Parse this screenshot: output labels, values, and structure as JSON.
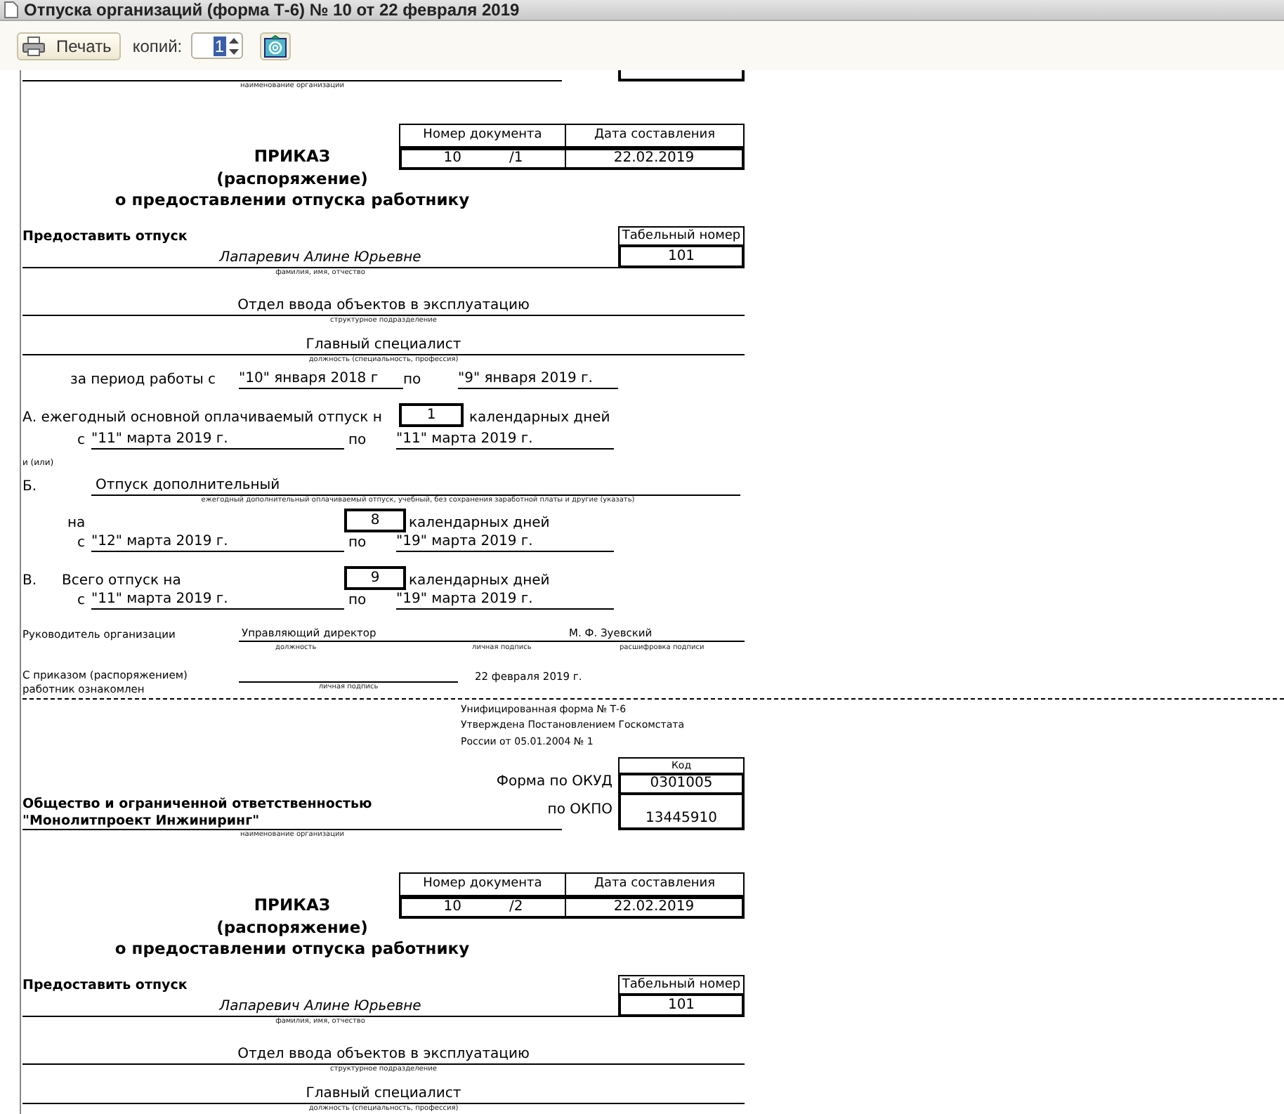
{
  "window": {
    "title": "Отпуска организаций (форма Т-6) № 10 от 22 февраля 2019"
  },
  "toolbar": {
    "print_button": "Печать",
    "copies_label": "копий:",
    "copies_value": "1"
  },
  "documents": [
    {
      "header": {
        "org_caption": "наименование организации"
      },
      "doc_table": {
        "number_header": "Номер документа",
        "date_header": "Дата составления",
        "number": "10",
        "suffix": "/1",
        "date": "22.02.2019"
      },
      "title": [
        "ПРИКАЗ",
        "(распоряжение)",
        "о предоставлении отпуска работнику"
      ],
      "grant_label": "Предоставить отпуск",
      "tab_header": "Табельный номер",
      "tab_number": "101",
      "employee": {
        "value": "Лапаревич Алине Юрьевне",
        "caption": "фамилия, имя, отчество"
      },
      "department": {
        "value": "Отдел ввода объектов в эксплуатацию",
        "caption": "структурное подразделение"
      },
      "position": {
        "value": "Главный специалист",
        "caption": "должность (специальность, профессия)"
      },
      "period": {
        "label": "за период работы с",
        "from": "\"10\" января 2018 г",
        "to_label": "по",
        "to": "\"9\" января 2019 г."
      },
      "leave_a": {
        "label": "А. ежегодный основной оплачиваемый отпуск н",
        "days": "1",
        "days_label": "календарных дней",
        "from_label": "с",
        "from": "\"11\" марта 2019 г.",
        "to_label": "по",
        "to": "\"11\" марта 2019 г."
      },
      "and_or": "и (или)",
      "leave_b": {
        "letter": "Б.",
        "type": "Отпуск дополнительный",
        "caption": "ежегодный дополнительный оплачиваемый отпуск, учебный, без сохранения заработной платы и другие (указать)",
        "on_label": "на",
        "days": "8",
        "days_label": "календарных дней",
        "from_label": "с",
        "from": "\"12\" марта 2019 г.",
        "to_label": "по",
        "to": "\"19\" марта 2019 г."
      },
      "total": {
        "letter": "В.",
        "label": "Всего отпуск на",
        "days": "9",
        "days_label": "календарных дней",
        "from_label": "с",
        "from": "\"11\" марта 2019 г.",
        "to_label": "по",
        "to": "\"19\" марта 2019 г."
      },
      "head_signature": {
        "label": "Руководитель организации",
        "position": "Управляющий директор",
        "name": "М. Ф. Зуевский",
        "captions": [
          "должность",
          "личная подпись",
          "расшифровка подписи"
        ]
      },
      "acknowledgement": {
        "label_lines": [
          "С приказом (распоряжением)",
          "работник ознакомлен"
        ],
        "caption": "личная подпись",
        "date": "22 февраля 2019 г."
      }
    },
    {
      "header": {
        "form_note": [
          "Унифицированная форма № Т-6",
          "Утверждена Постановлением Госкомстата",
          "России от 05.01.2004 № 1"
        ],
        "code_header": "Код",
        "okud_label": "Форма по ОКУД",
        "okud": "0301005",
        "okpo_label": "по ОКПО",
        "okpo": "13445910",
        "org_name": [
          "Общество и ограниченной ответственностью",
          "\"Монолитпроект Инжиниринг\""
        ],
        "org_caption": "наименование организации"
      },
      "doc_table": {
        "number_header": "Номер документа",
        "date_header": "Дата составления",
        "number": "10",
        "suffix": "/2",
        "date": "22.02.2019"
      },
      "title": [
        "ПРИКАЗ",
        "(распоряжение)",
        "о предоставлении отпуска работнику"
      ],
      "grant_label": "Предоставить отпуск",
      "tab_header": "Табельный номер",
      "tab_number": "101",
      "employee": {
        "value": "Лапаревич Алине Юрьевне",
        "caption": "фамилия, имя, отчество"
      },
      "department": {
        "value": "Отдел ввода объектов в эксплуатацию",
        "caption": "структурное подразделение"
      },
      "position": {
        "value": "Главный специалист",
        "caption": "должность (специальность, профессия)"
      }
    }
  ]
}
